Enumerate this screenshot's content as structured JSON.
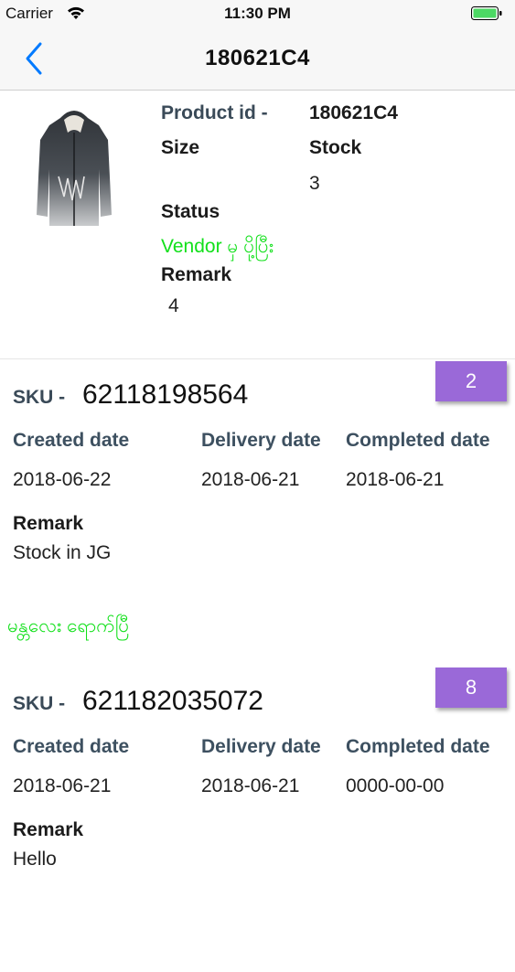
{
  "status_bar": {
    "carrier": "Carrier",
    "time": "11:30 PM",
    "wifi_icon": "wifi-icon",
    "battery_icon": "battery-icon"
  },
  "nav": {
    "title": "180621C4",
    "back_icon": "chevron-left-icon"
  },
  "product": {
    "image_icon": "hoodie-product-image",
    "product_id_label": "Product id -",
    "product_id_value": "180621C4",
    "size_label": "Size",
    "stock_label": "Stock",
    "stock_value": "3",
    "status_label": "Status",
    "status_value": "Vendor မှ ပို့ပြီး",
    "remark_label": "Remark",
    "remark_value": "4"
  },
  "labels": {
    "sku_prefix": "SKU -",
    "created": "Created date",
    "delivery": "Delivery date",
    "completed": "Completed date",
    "remark": "Remark"
  },
  "skus": [
    {
      "sku": "62118198564",
      "badge": "2",
      "created": "2018-06-22",
      "delivery": "2018-06-21",
      "completed": "2018-06-21",
      "remark": "Stock in JG",
      "status": "မန္တလေး ရောက်ပြီ"
    },
    {
      "sku": "621182035072",
      "badge": "8",
      "created": "2018-06-21",
      "delivery": "2018-06-21",
      "completed": "0000-00-00",
      "remark": "Hello",
      "status": ""
    }
  ],
  "colors": {
    "accent": "#007aff",
    "status_green": "#12e01b",
    "badge_purple": "#9a69d8",
    "label_slate": "#3d5060"
  }
}
